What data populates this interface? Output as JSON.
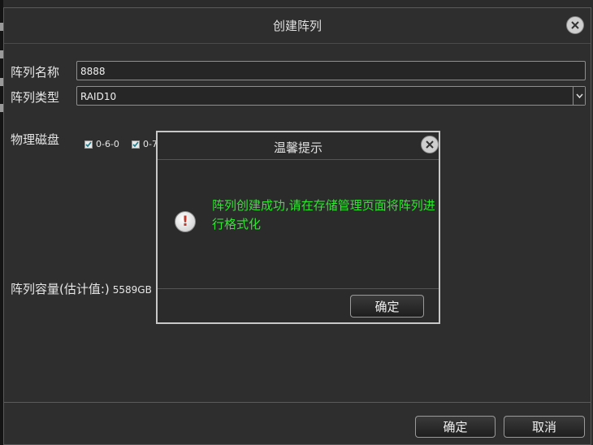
{
  "dialog": {
    "title": "创建阵列",
    "close_icon": "close-icon"
  },
  "form": {
    "name_label": "阵列名称",
    "name_value": "8888",
    "type_label": "阵列类型",
    "type_value": "RAID10",
    "disk_label": "物理磁盘",
    "disks": [
      {
        "label": "0-6-0",
        "checked": true
      },
      {
        "label": "0-7",
        "checked": true
      }
    ],
    "capacity_label": "阵列容量(估计值:)",
    "capacity_value": "5589GB"
  },
  "footer": {
    "ok_label": "确定",
    "cancel_label": "取消"
  },
  "modal": {
    "title": "温馨提示",
    "icon": "warning-icon",
    "message": "阵列创建成功,请在存储管理页面将阵列进行格式化",
    "message_color": "#2ee62e",
    "ok_label": "确定"
  }
}
